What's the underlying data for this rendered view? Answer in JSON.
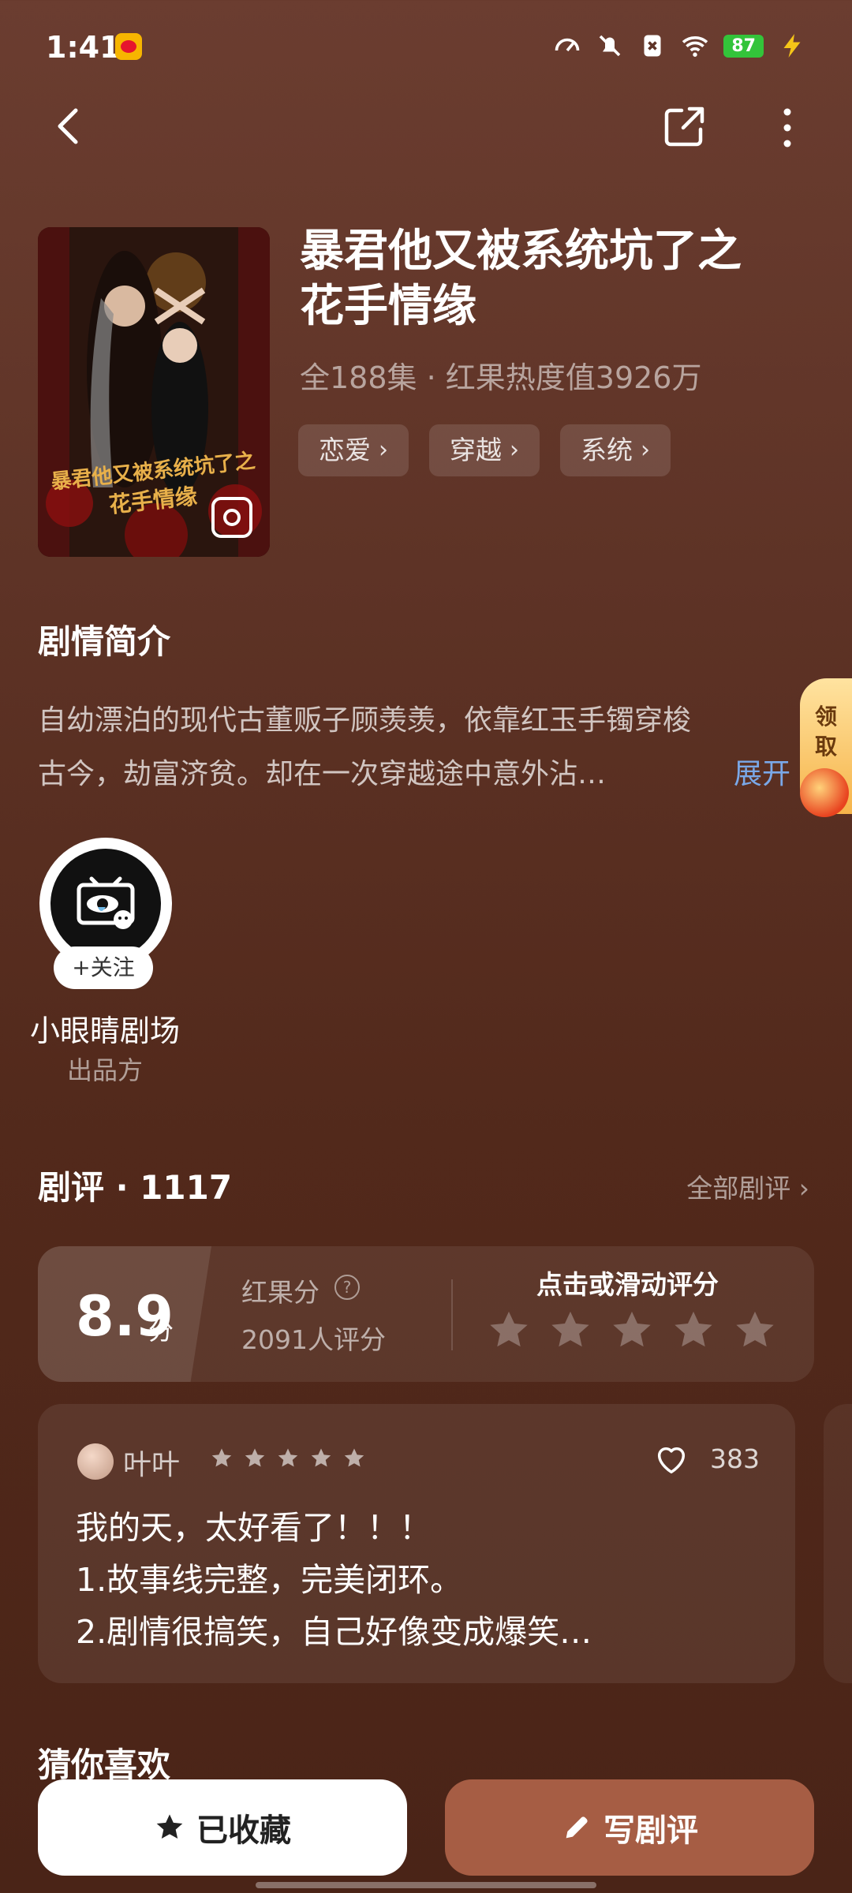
{
  "status_bar": {
    "time": "1:41",
    "battery": "87"
  },
  "drama": {
    "title": "暴君他又被系统坑了之花手情缘",
    "title_line1": "暴君他又被系统坑了之",
    "title_line2": "花手情缘",
    "meta": "全188集 · 红果热度值3926万",
    "poster_text": "暴君他又被系统坑了之花手情缘",
    "tags": [
      "恋爱",
      "穿越",
      "系统"
    ]
  },
  "synopsis": {
    "title": "剧情简介",
    "line1": "自幼漂泊的现代古董贩子顾羡羡，依靠红玉手镯穿梭",
    "line2": "古今，劫富济贫。却在一次穿越途中意外沾…",
    "expand": "展开"
  },
  "claim": {
    "line1": "领",
    "line2": "取"
  },
  "producer": {
    "follow": "+关注",
    "name": "小眼睛剧场",
    "role": "出品方"
  },
  "reviews": {
    "title": "剧评 · 1117",
    "all": "全部剧评",
    "score": "8.9",
    "score_unit": "分",
    "rg_label": "红果分",
    "rg_count": "2091人评分",
    "rate_label": "点击或滑动评分",
    "rate_stars": 5,
    "item": {
      "user": "叶叶",
      "stars": 5,
      "likes": "383",
      "line1": "我的天，太好看了！！！",
      "line2": "1.故事线完整，完美闭环。",
      "line3": "2.剧情很搞笑，自己好像变成爆笑…"
    }
  },
  "recommend": {
    "title": "猜你喜欢"
  },
  "buttons": {
    "favorited": "已收藏",
    "write_review": "写剧评"
  },
  "colors": {
    "accent_blue": "#7aa8e8",
    "write_btn": "#a65d44",
    "bg": "#5e3326"
  }
}
